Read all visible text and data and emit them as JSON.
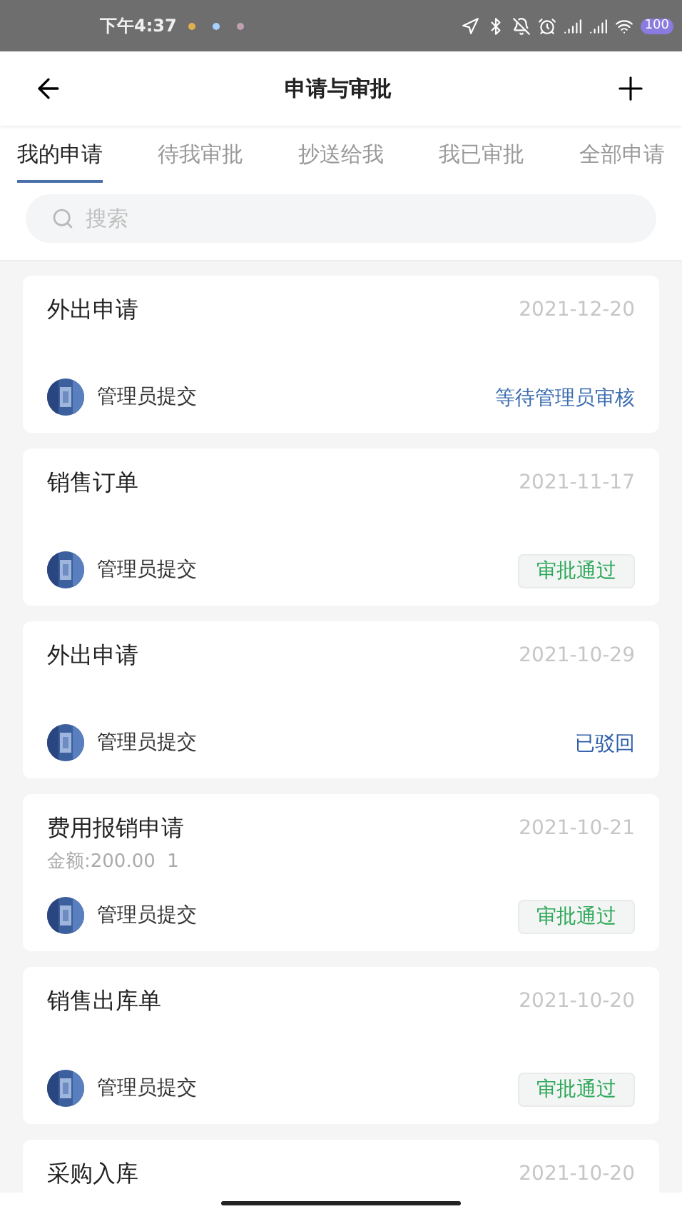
{
  "status_bar": {
    "time": "下午4:37",
    "battery": "100"
  },
  "header": {
    "title": "申请与审批"
  },
  "tabs": [
    {
      "label": "我的申请",
      "selected": true
    },
    {
      "label": "待我审批",
      "selected": false
    },
    {
      "label": "抄送给我",
      "selected": false
    },
    {
      "label": "我已审批",
      "selected": false
    },
    {
      "label": "全部申请",
      "selected": false
    }
  ],
  "search": {
    "placeholder": "搜索"
  },
  "requests": [
    {
      "title": "外出申请",
      "date": "2021-12-20",
      "submitter": "管理员提交",
      "status": {
        "kind": "pending",
        "label": "等待管理员审核"
      }
    },
    {
      "title": "销售订单",
      "date": "2021-11-17",
      "submitter": "管理员提交",
      "status": {
        "kind": "approved",
        "label": "审批通过"
      }
    },
    {
      "title": "外出申请",
      "date": "2021-10-29",
      "submitter": "管理员提交",
      "status": {
        "kind": "rejected",
        "label": "已驳回"
      }
    },
    {
      "title": "费用报销申请",
      "date": "2021-10-21",
      "detail": "金额:200.00  1",
      "submitter": "管理员提交",
      "status": {
        "kind": "approved",
        "label": "审批通过"
      }
    },
    {
      "title": "销售出库单",
      "date": "2021-10-20",
      "submitter": "管理员提交",
      "status": {
        "kind": "approved",
        "label": "审批通过"
      }
    },
    {
      "title": "采购入库",
      "date": "2021-10-20"
    }
  ]
}
